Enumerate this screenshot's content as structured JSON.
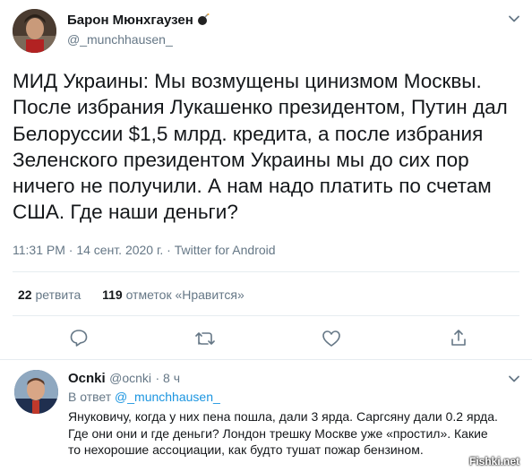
{
  "tweet": {
    "author_name": "Барон Мюнхгаузен",
    "author_handle": "@_munchhausen_",
    "text_lines": [
      "МИД Украины: Мы возмущены цинизмом Москвы.",
      "После избрания Лукашенко президентом, Путин дал",
      "Белоруссии $1,5 млрд. кредита, а после избрания",
      "Зеленского президентом Украины мы до сих пор",
      "ничего не получили. А нам надо платить по счетам",
      "США. Где наши деньги?"
    ],
    "timestamp": "11:31 PM · 14 сент. 2020 г. · Twitter for Android",
    "retweets_count": "22",
    "retweets_label": "ретвита",
    "likes_count": "119",
    "likes_label": "отметок «Нравится»"
  },
  "reply": {
    "author_name": "Ocnki",
    "author_handle": "@ocnki",
    "time": "· 8 ч",
    "in_reply_prefix": "В ответ",
    "in_reply_handle": "@_munchhausen_",
    "text_lines": [
      "Януковичу, когда у них пена пошла, дали 3 ярда. Саргсяну дали 0.2 ярда.",
      "Где они они и где деньги? Лондон трешку Москве уже «простил». Какие",
      "то нехорошие ассоциации, как будто тушат пожар бензином."
    ]
  },
  "watermark": "Fishki.net",
  "colors": {
    "text": "#14171a",
    "secondary": "#657786",
    "link": "#1b95e0",
    "divider": "#e6ecf0"
  },
  "icons": [
    "chevron-down-icon",
    "reply-icon",
    "retweet-icon",
    "like-icon",
    "share-icon",
    "bomb-emoji-icon"
  ]
}
